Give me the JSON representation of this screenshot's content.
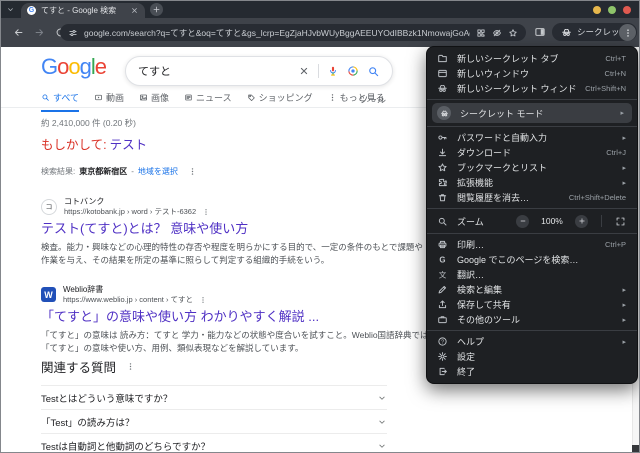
{
  "window": {
    "controls": [
      {
        "name": "minimize-button"
      },
      {
        "name": "maximize-button"
      },
      {
        "name": "close-button"
      }
    ]
  },
  "browser": {
    "tab": {
      "title": "てすと - Google 検索",
      "favicon": "google-favicon"
    },
    "toolbar": {
      "url": "google.com/search?q=てすと&oq=てすと&gs_lcrp=EgZjaHJvbWUyBggAEEUYOdIBBzk1NmowajGoAgCwAgA&sourceid=ch…",
      "incognito_label": "シークレット"
    }
  },
  "menu": {
    "items": [
      {
        "type": "item",
        "name": "new-incognito-tab",
        "icon": "incognito-tab-icon",
        "label": "新しいシークレット タブ",
        "shortcut": "Ctrl+T"
      },
      {
        "type": "item",
        "name": "new-window",
        "icon": "new-window-icon",
        "label": "新しいウィンドウ",
        "shortcut": "Ctrl+N"
      },
      {
        "type": "item",
        "name": "new-incognito-window",
        "icon": "incognito-icon",
        "label": "新しいシークレット ウィンドウ",
        "shortcut": "Ctrl+Shift+N"
      },
      {
        "type": "separator"
      },
      {
        "type": "item",
        "name": "incognito-mode",
        "icon": "incognito-icon",
        "label": "シークレット モード",
        "submenu": true,
        "highlighted": true,
        "avatar": true
      },
      {
        "type": "separator"
      },
      {
        "type": "item",
        "name": "passwords-autofill",
        "icon": "key-icon",
        "label": "パスワードと自動入力",
        "submenu": true
      },
      {
        "type": "item",
        "name": "downloads",
        "icon": "download-icon",
        "label": "ダウンロード",
        "shortcut": "Ctrl+J"
      },
      {
        "type": "item",
        "name": "bookmarks-lists",
        "icon": "star-icon",
        "label": "ブックマークとリスト",
        "submenu": true
      },
      {
        "type": "item",
        "name": "extensions",
        "icon": "puzzle-icon",
        "label": "拡張機能",
        "submenu": true
      },
      {
        "type": "item",
        "name": "clear-browsing-data",
        "icon": "trash-icon",
        "label": "閲覧履歴を消去…",
        "shortcut": "Ctrl+Shift+Delete"
      },
      {
        "type": "separator"
      },
      {
        "type": "zoom",
        "name": "zoom",
        "icon": "magnifier-icon",
        "label": "ズーム",
        "value": "100%"
      },
      {
        "type": "separator"
      },
      {
        "type": "item",
        "name": "print",
        "icon": "printer-icon",
        "label": "印刷…",
        "shortcut": "Ctrl+P"
      },
      {
        "type": "item",
        "name": "search-page-with-google",
        "icon": "g-letter-icon",
        "label": "Google でこのページを検索…"
      },
      {
        "type": "item",
        "name": "translate",
        "icon": "translate-icon",
        "label": "翻訳…"
      },
      {
        "type": "item",
        "name": "find-and-edit",
        "icon": "edit-icon",
        "label": "検索と編集",
        "submenu": true
      },
      {
        "type": "item",
        "name": "save-and-share",
        "icon": "save-share-icon",
        "label": "保存して共有",
        "submenu": true
      },
      {
        "type": "item",
        "name": "more-tools",
        "icon": "tools-icon",
        "label": "その他のツール",
        "submenu": true
      },
      {
        "type": "separator"
      },
      {
        "type": "item",
        "name": "help",
        "icon": "help-icon",
        "label": "ヘルプ",
        "submenu": true
      },
      {
        "type": "item",
        "name": "settings",
        "icon": "gear-icon",
        "label": "設定"
      },
      {
        "type": "item",
        "name": "exit",
        "icon": "exit-icon",
        "label": "終了"
      }
    ]
  },
  "page": {
    "logo": "Google",
    "logo_colors": [
      "#4285F4",
      "#EA4335",
      "#FBBC05",
      "#4285F4",
      "#34A853",
      "#EA4335"
    ],
    "search": {
      "query": "てすと"
    },
    "tabs": [
      {
        "label": "すべて",
        "icon": "magnifier-icon",
        "active": true
      },
      {
        "label": "動画",
        "icon": "video-icon"
      },
      {
        "label": "画像",
        "icon": "image-icon"
      },
      {
        "label": "ニュース",
        "icon": "news-icon"
      },
      {
        "label": "ショッピング",
        "icon": "shopping-icon"
      },
      {
        "label": "もっと見る",
        "icon": "dots-v-icon"
      }
    ],
    "tools_label": "ツール",
    "stats": "約 2,410,000 件 (0.20 秒)",
    "correction": {
      "label": "もしかして:",
      "query": "テスト"
    },
    "location": {
      "label": "検索結果:",
      "value": "東京都新宿区",
      "separator": "-",
      "action": "地域を選択"
    },
    "results": [
      {
        "favicon": "kotobank",
        "favicon_text": "コ",
        "site": "コトバンク",
        "url": "https://kotobank.jp › word › テスト-6362",
        "title": "テスト(てすと)とは？ 意味や使い方",
        "snippet": "検査。能力・興味などの心理的特性の存否や程度を明らかにする目的で、一定の条件のもとで課題や作業を与え、その結果を所定の基準に照らして判定する組織的手続をいう。"
      },
      {
        "favicon": "weblio",
        "favicon_text": "W",
        "site": "Weblio辞書",
        "url": "https://www.weblio.jp › content › てすと",
        "title": "「てすと」の意味や使い方 わかりやすく解説 ...",
        "snippet": "「てすと」の意味は 読み方：てすと 学力・能力などの状態や度合いを試すこと。Weblio国語辞典では「てすと」の意味や使い方、用例、類似表現などを解説しています。"
      }
    ],
    "related": {
      "title": "関連する質問",
      "questions": [
        "Testとはどういう意味ですか？",
        "「Test」の読み方は？",
        "Testは自動詞と他動詞のどちらですか？"
      ]
    }
  },
  "colors": {
    "accent_blue": "#1a73e8",
    "link_purple": "#4f30c4",
    "correction_red": "#d93025",
    "toolbar_dark": "#3f434a",
    "tabstrip_dark": "#252a31",
    "menu_dark": "#1e2023"
  }
}
